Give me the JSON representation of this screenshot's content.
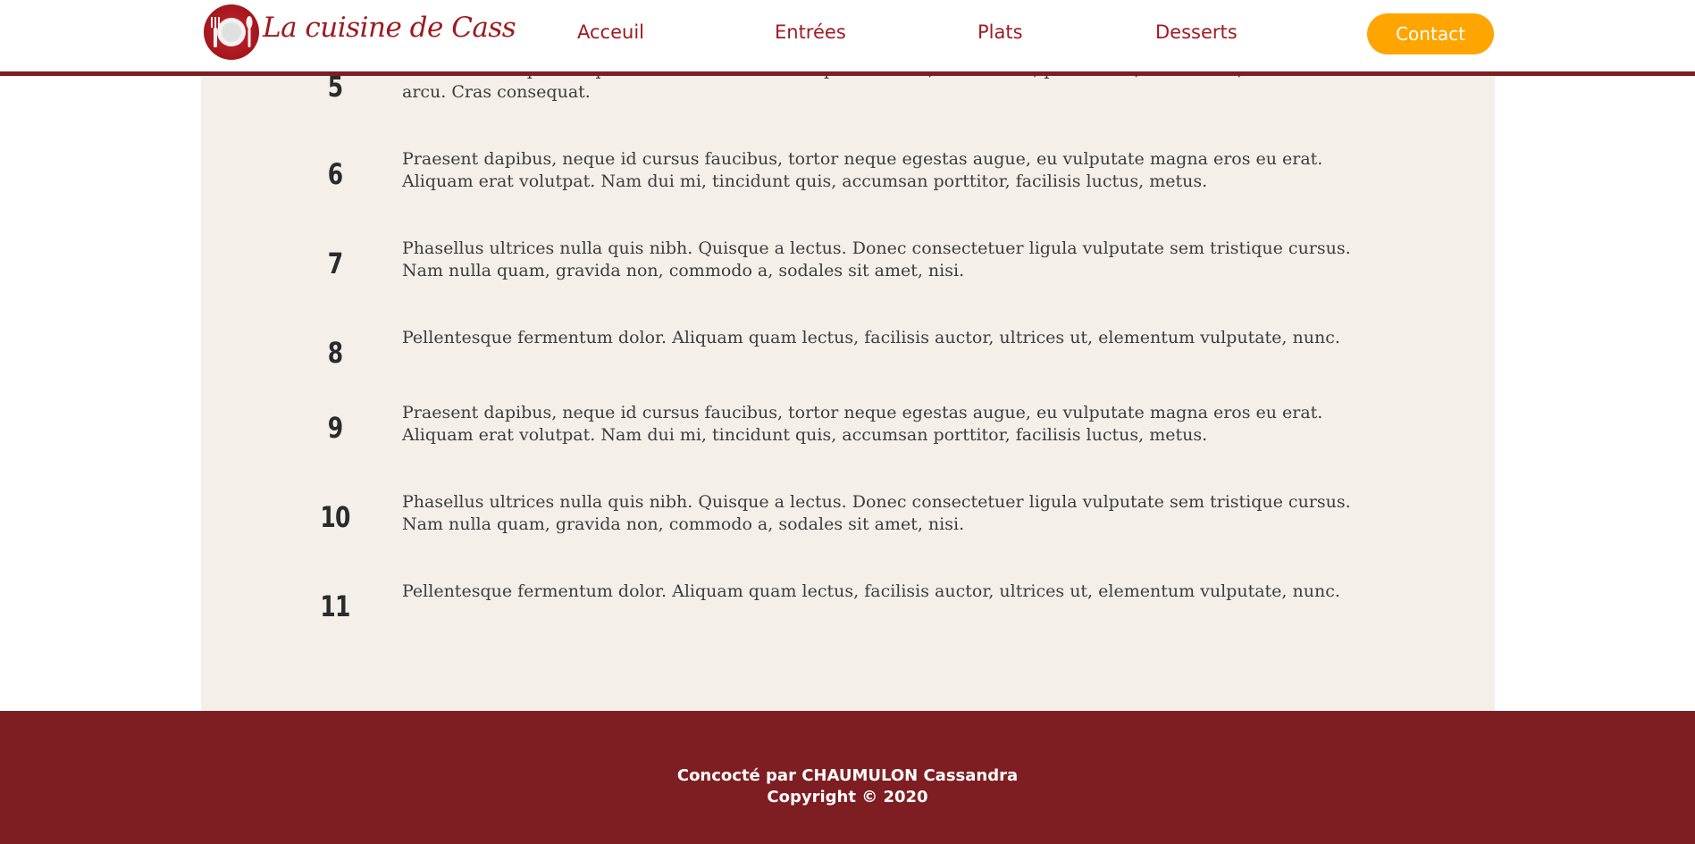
{
  "header": {
    "logo_text": "La cuisine de Cass",
    "nav": {
      "acceuil": "Acceuil",
      "entrees": "Entrées",
      "plats": "Plats",
      "desserts": "Desserts"
    },
    "contact_label": "Contact"
  },
  "steps": [
    {
      "number": "5",
      "text": "Morbi in sem quis dui placerat ornare. Pellentesque odio nisi, euismod in, pharetra a, ultricies in, diam. Sed arcu. Cras consequat."
    },
    {
      "number": "6",
      "text": "Praesent dapibus, neque id cursus faucibus, tortor neque egestas augue, eu vulputate magna eros eu erat. Aliquam erat volutpat. Nam dui mi, tincidunt quis, accumsan porttitor, facilisis luctus, metus."
    },
    {
      "number": "7",
      "text": "Phasellus ultrices nulla quis nibh. Quisque a lectus. Donec consectetuer ligula vulputate sem tristique cursus. Nam nulla quam, gravida non, commodo a, sodales sit amet, nisi."
    },
    {
      "number": "8",
      "text": "Pellentesque fermentum dolor. Aliquam quam lectus, facilisis auctor, ultrices ut, elementum vulputate, nunc."
    },
    {
      "number": "9",
      "text": "Praesent dapibus, neque id cursus faucibus, tortor neque egestas augue, eu vulputate magna eros eu erat. Aliquam erat volutpat. Nam dui mi, tincidunt quis, accumsan porttitor, facilisis luctus, metus."
    },
    {
      "number": "10",
      "text": "Phasellus ultrices nulla quis nibh. Quisque a lectus. Donec consectetuer ligula vulputate sem tristique cursus. Nam nulla quam, gravida non, commodo a, sodales sit amet, nisi."
    },
    {
      "number": "11",
      "text": "Pellentesque fermentum dolor. Aliquam quam lectus, facilisis auctor, ultrices ut, elementum vulputate, nunc."
    }
  ],
  "footer": {
    "credit": "Concocté par CHAUMULON Cassandra",
    "copyright": "Copyright © 2020"
  },
  "colors": {
    "brand_red": "#7e1e22",
    "nav_red": "#a11b22",
    "accent_orange": "#ffa500",
    "panel_cream": "#f4efe9"
  }
}
